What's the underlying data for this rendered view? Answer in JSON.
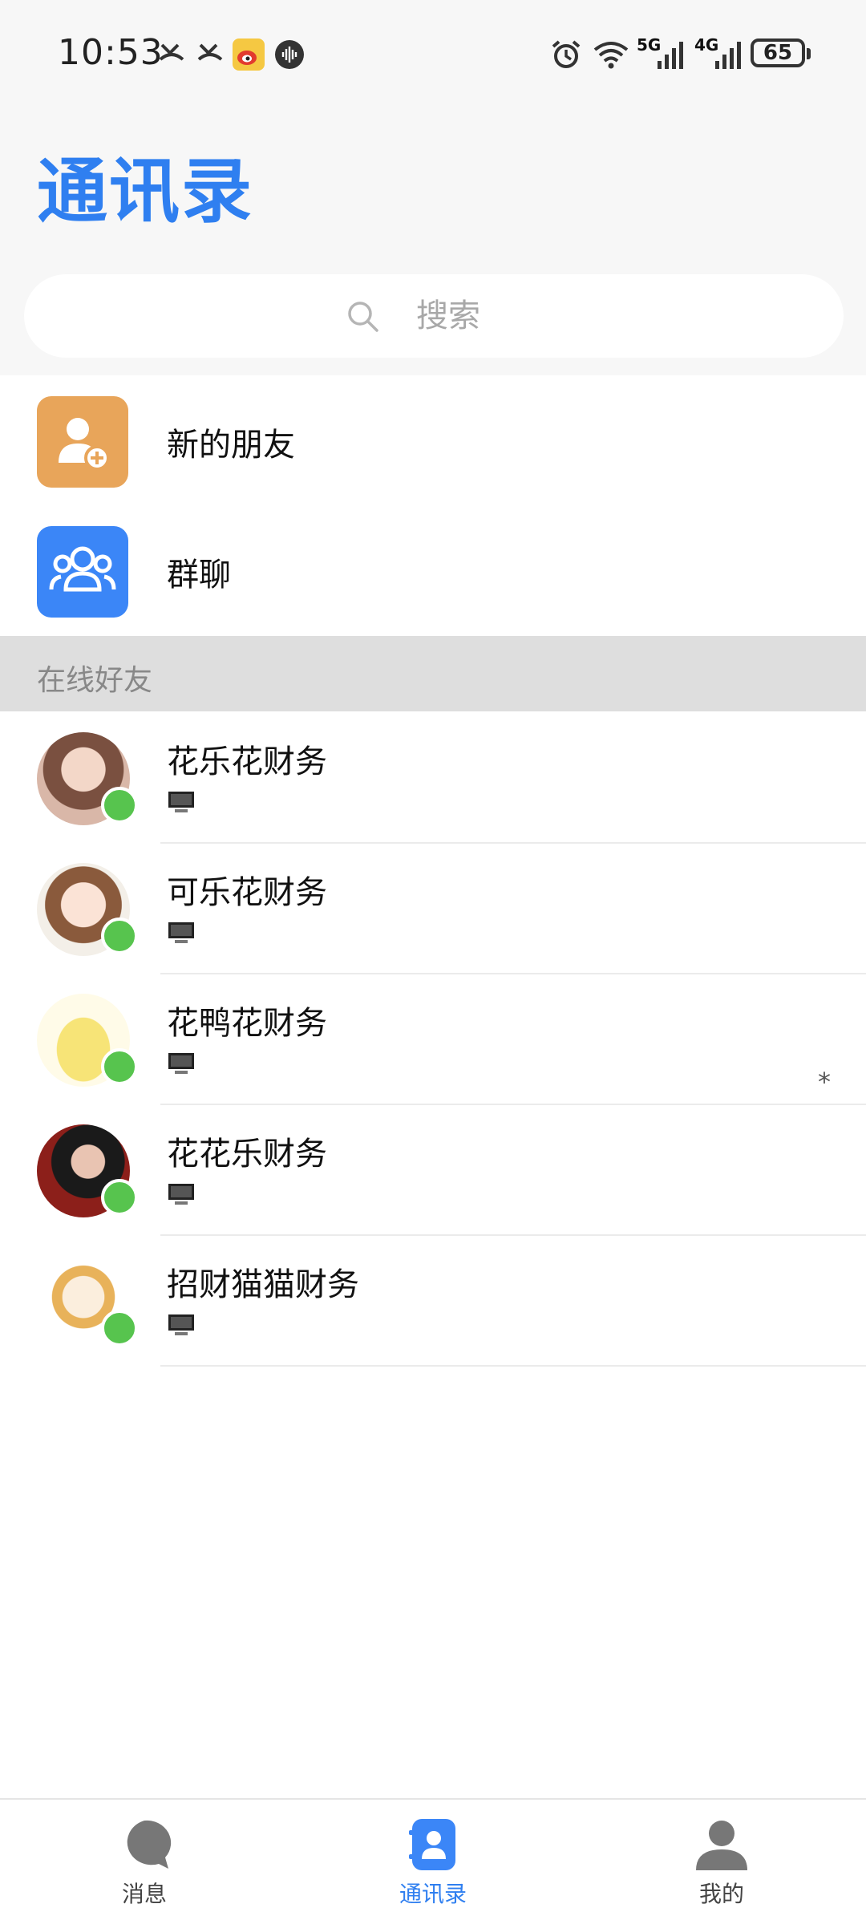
{
  "status_bar": {
    "time": "10:53",
    "net_5g": "5G",
    "net_4g": "4G",
    "battery": "65"
  },
  "header": {
    "title": "通讯录"
  },
  "search": {
    "placeholder": "搜索"
  },
  "features": [
    {
      "label": "新的朋友",
      "icon": "add-friend-icon",
      "color": "#e8a55a"
    },
    {
      "label": "群聊",
      "icon": "group-chat-icon",
      "color": "#3b86f7"
    }
  ],
  "section": {
    "title": "在线好友"
  },
  "contacts": [
    {
      "name": "花乐花财务",
      "status": "online",
      "device": "desktop-icon"
    },
    {
      "name": "可乐花财务",
      "status": "online",
      "device": "desktop-icon"
    },
    {
      "name": "花鸭花财务",
      "status": "online",
      "device": "desktop-icon"
    },
    {
      "name": "花花乐财务",
      "status": "online",
      "device": "desktop-icon"
    },
    {
      "name": "招财猫猫财务",
      "status": "online",
      "device": "desktop-icon"
    }
  ],
  "mark": "*",
  "nav": {
    "items": [
      {
        "label": "消息",
        "icon": "message-bubble-icon"
      },
      {
        "label": "通讯录",
        "icon": "contacts-book-icon",
        "active": true
      },
      {
        "label": "我的",
        "icon": "profile-icon"
      }
    ]
  },
  "colors": {
    "accent": "#2f7ff0",
    "online": "#57c44e",
    "section_bg": "#dedede",
    "top_bg": "#f7f7f7"
  }
}
